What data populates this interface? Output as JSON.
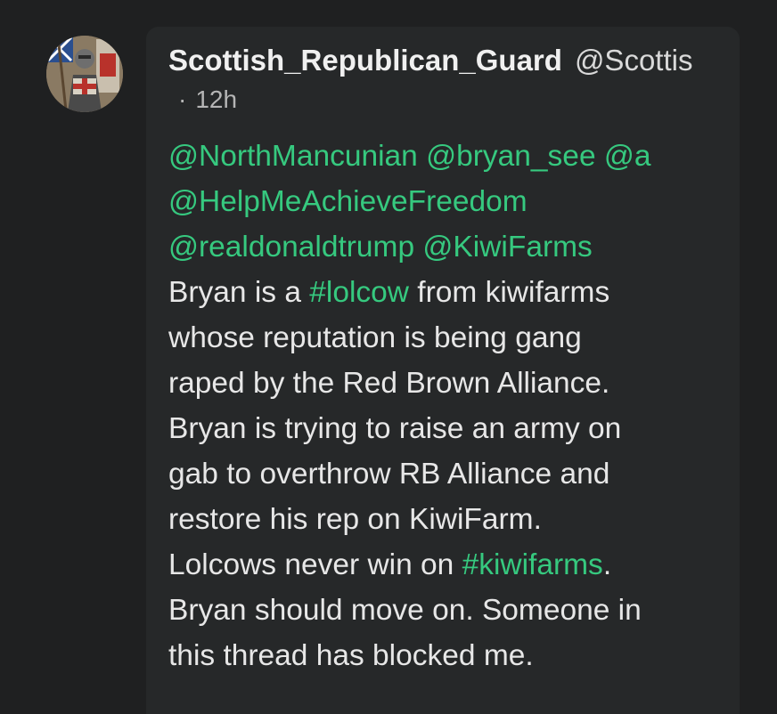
{
  "post": {
    "author": {
      "display_name": "Scottish_Republican_Guard",
      "handle": "@Scottis",
      "avatar_icon": "knight-avatar-icon"
    },
    "meta": {
      "separator": "·",
      "time": "12h"
    },
    "mentions": {
      "m1": "@NorthMancunian",
      "m2": "@bryan_see",
      "m3": "@a",
      "m4": "@HelpMeAchieveFreedom",
      "m5": "@realdonaldtrump",
      "m6": "@KiwiFarms"
    },
    "hashtags": {
      "h1": "#lolcow",
      "h2": "#kiwifarms"
    },
    "text": {
      "t1a": "Bryan is a ",
      "t1b": " from kiwifarms",
      "t2": "whose reputation is being gang",
      "t3": "raped by the Red Brown Alliance.",
      "t4": "Bryan is trying to raise an army on",
      "t5": "gab to overthrow RB Alliance and",
      "t6": "restore his rep on KiwiFarm.",
      "t7a": "Lolcows never win on ",
      "t7b": ".",
      "t8": "Bryan should move on. Someone in",
      "t9": "this thread has blocked me."
    }
  },
  "colors": {
    "background": "#1f2021",
    "card": "#262829",
    "link": "#36c97f",
    "text": "#e7e7e7"
  }
}
